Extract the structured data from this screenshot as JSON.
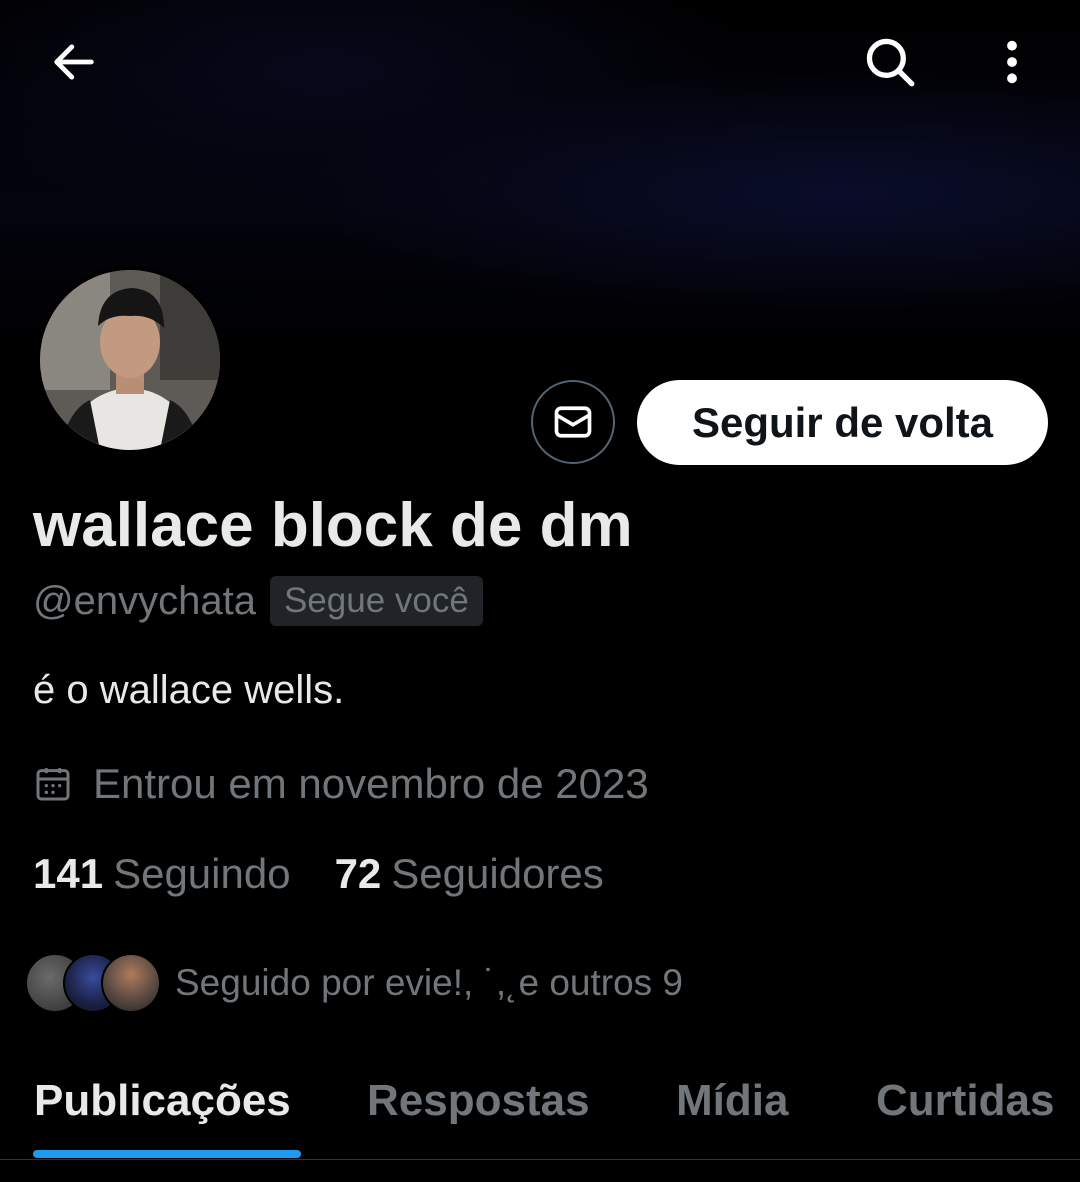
{
  "header": {
    "back_icon": "arrow-left-icon",
    "search_icon": "search-icon",
    "more_icon": "more-vertical-icon"
  },
  "profile": {
    "name": "wallace block de dm",
    "handle": "@envychata",
    "follows_you_badge": "Segue você",
    "bio": "é o wallace wells.",
    "joined": "Entrou em novembro de 2023",
    "following_count": "141",
    "following_label": "Seguindo",
    "followers_count": "72",
    "followers_label": "Seguidores",
    "followed_by": "Seguido por evie!, ˙,˛e outros 9"
  },
  "actions": {
    "message_icon": "mail-icon",
    "follow_back_label": "Seguir de volta"
  },
  "tabs": [
    {
      "label": "Publicações",
      "active": true
    },
    {
      "label": "Respostas",
      "active": false
    },
    {
      "label": "Mídia",
      "active": false
    },
    {
      "label": "Curtidas",
      "active": false
    }
  ],
  "colors": {
    "background": "#000000",
    "primary_text": "#e7e9ea",
    "secondary_text": "#71767b",
    "accent": "#1d9bf0"
  }
}
